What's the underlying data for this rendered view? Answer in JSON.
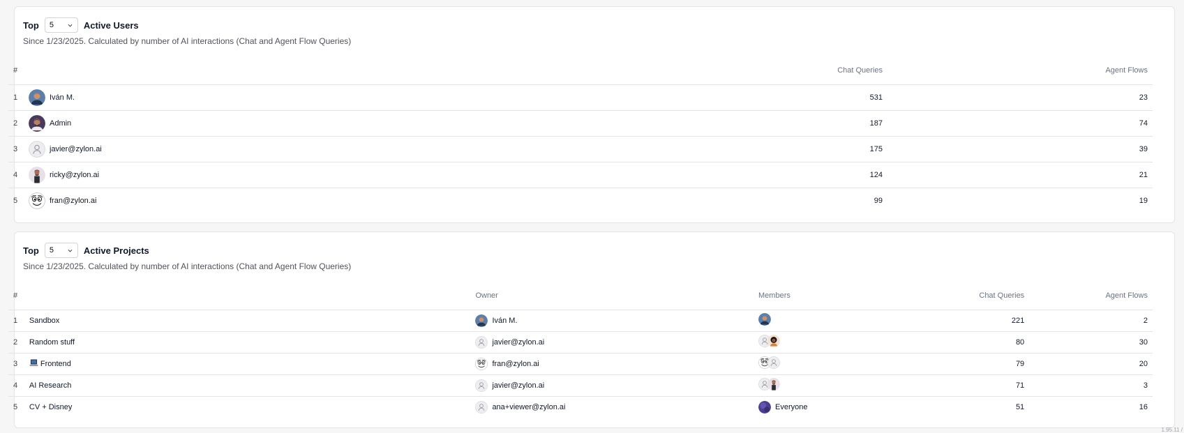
{
  "users_section": {
    "top_label": "Top",
    "select_value": "5",
    "title": "Active Users",
    "subtitle": "Since 1/23/2025. Calculated by number of AI interactions (Chat and Agent Flow Queries)",
    "columns": {
      "rank": "#",
      "chat": "Chat Queries",
      "agent": "Agent Flows"
    },
    "rows": [
      {
        "rank": "1",
        "name": "Iván M.",
        "avatar": "photo-blue-avatar",
        "chat": "531",
        "agent": "23"
      },
      {
        "rank": "2",
        "name": "Admin",
        "avatar": "photo-purple-avatar",
        "chat": "187",
        "agent": "74"
      },
      {
        "rank": "3",
        "name": "javier@zylon.ai",
        "avatar": "default-user-avatar",
        "chat": "175",
        "agent": "39"
      },
      {
        "rank": "4",
        "name": "ricky@zylon.ai",
        "avatar": "photo-person-avatar",
        "chat": "124",
        "agent": "21"
      },
      {
        "rank": "5",
        "name": "fran@zylon.ai",
        "avatar": "cartoon-face-avatar",
        "chat": "99",
        "agent": "19"
      }
    ]
  },
  "projects_section": {
    "top_label": "Top",
    "select_value": "5",
    "title": "Active Projects",
    "subtitle": "Since 1/23/2025. Calculated by number of AI interactions (Chat and Agent Flow Queries)",
    "columns": {
      "rank": "#",
      "owner": "Owner",
      "members": "Members",
      "chat": "Chat Queries",
      "agent": "Agent Flows"
    },
    "rows": [
      {
        "rank": "1",
        "name": "Sandbox",
        "owner": "Iván M.",
        "chat": "221",
        "agent": "2"
      },
      {
        "rank": "2",
        "name": "Random stuff",
        "owner": "javier@zylon.ai",
        "chat": "80",
        "agent": "30"
      },
      {
        "rank": "3",
        "name": "Frontend",
        "icon": "laptop-emoji-icon",
        "owner": "fran@zylon.ai",
        "chat": "79",
        "agent": "20"
      },
      {
        "rank": "4",
        "name": "AI Research",
        "owner": "javier@zylon.ai",
        "chat": "71",
        "agent": "3"
      },
      {
        "rank": "5",
        "name": "CV + Disney",
        "owner": "ana+viewer@zylon.ai",
        "members_label": "Everyone",
        "chat": "51",
        "agent": "16"
      }
    ]
  },
  "footer": {
    "version": "1.95.11 /"
  },
  "colors": {
    "border": "#e4e4e7",
    "muted_text": "#6b7280",
    "text": "#111827"
  }
}
